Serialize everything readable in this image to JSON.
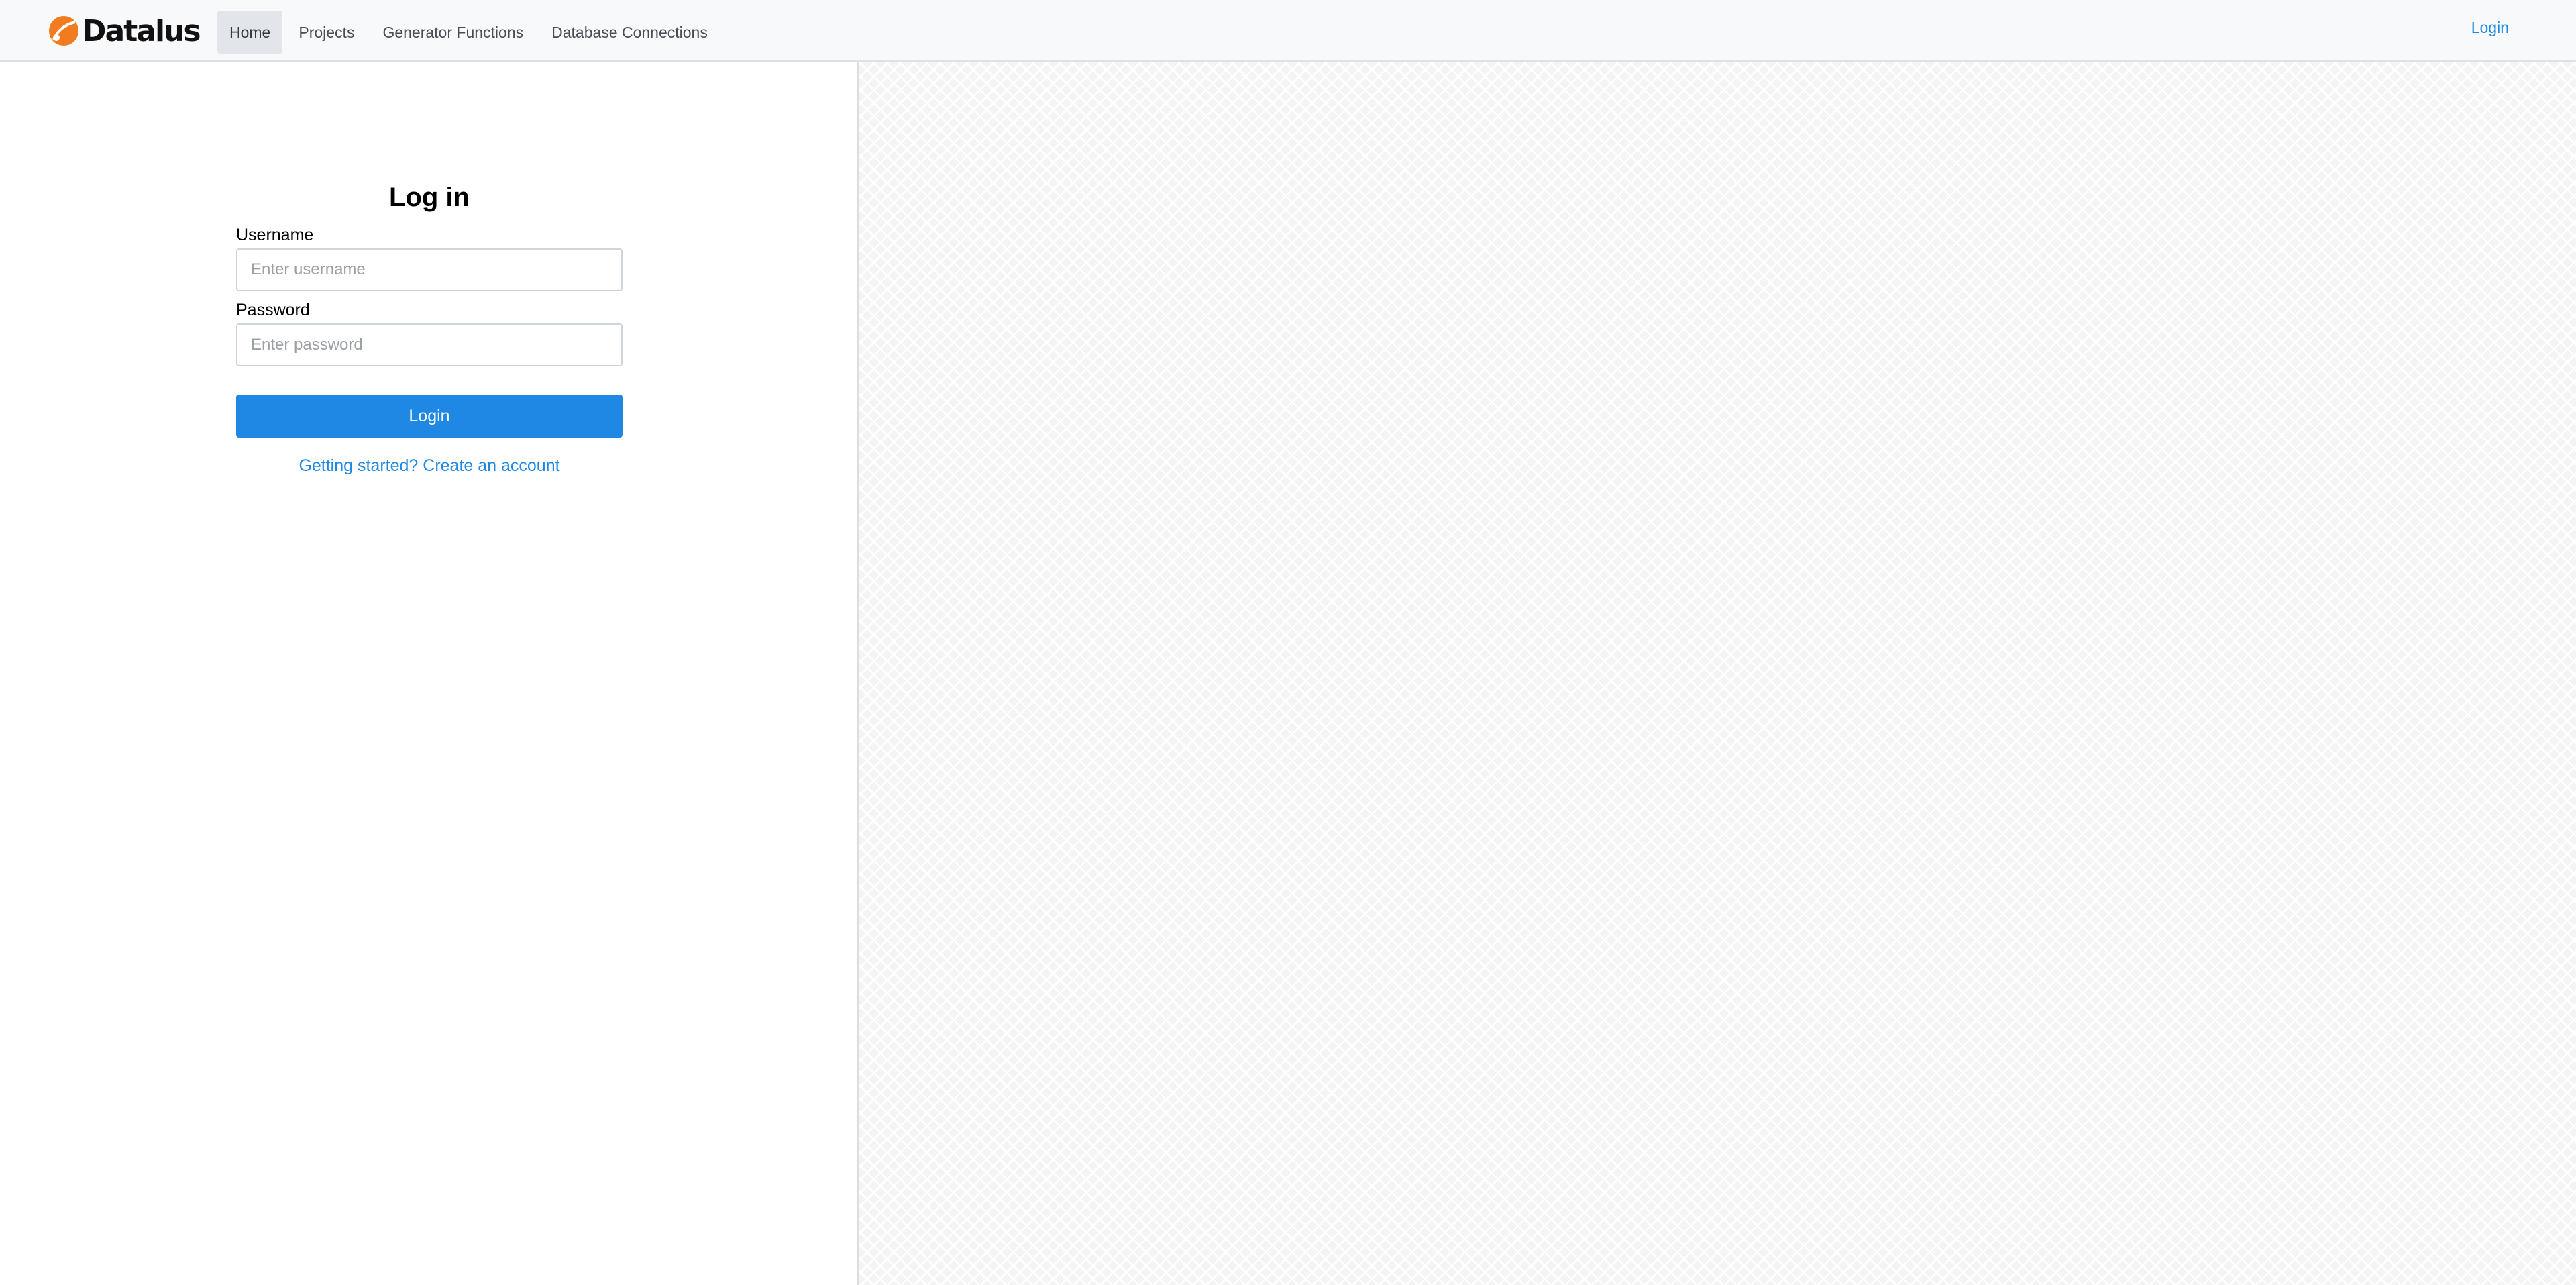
{
  "brand": {
    "name": "Datalus"
  },
  "nav": {
    "items": [
      {
        "label": "Home"
      },
      {
        "label": "Projects"
      },
      {
        "label": "Generator Functions"
      },
      {
        "label": "Database Connections"
      }
    ],
    "login_label": "Login"
  },
  "login_form": {
    "title": "Log in",
    "username_label": "Username",
    "username_placeholder": "Enter username",
    "username_value": "",
    "password_label": "Password",
    "password_placeholder": "Enter password",
    "password_value": "",
    "submit_label": "Login",
    "signup_link": "Getting started? Create an account"
  },
  "colors": {
    "accent": "#1f88e5",
    "logo_orange": "#f07c1f",
    "nav_bg": "#f8f9fb"
  },
  "icons": {
    "brand": "datalus-logo-icon"
  }
}
